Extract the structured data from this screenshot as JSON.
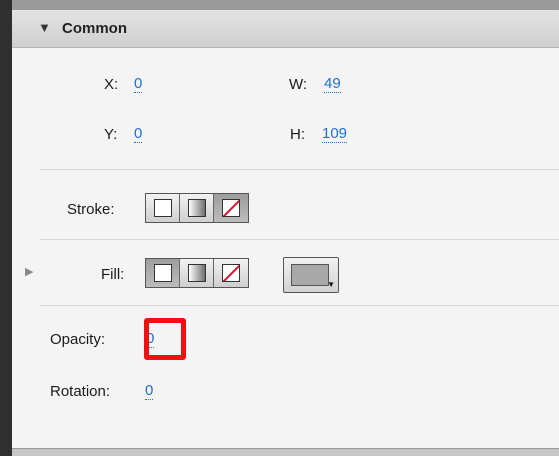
{
  "section": {
    "title": "Common",
    "expand_icon": "triangle-down-icon"
  },
  "position": {
    "x_label": "X:",
    "x_value": "0",
    "y_label": "Y:",
    "y_value": "0"
  },
  "size": {
    "w_label": "W:",
    "w_value": "49",
    "h_label": "H:",
    "h_value": "109"
  },
  "stroke": {
    "label": "Stroke:",
    "options": [
      "solid-swatch-icon",
      "gradient-swatch-icon",
      "none-swatch-icon"
    ],
    "selected": "none"
  },
  "fill": {
    "label": "Fill:",
    "options": [
      "solid-swatch-icon",
      "gradient-swatch-icon",
      "none-swatch-icon"
    ],
    "selected": "solid",
    "color": "#a9a9a9"
  },
  "opacity": {
    "label": "Opacity:",
    "value": "0"
  },
  "rotation": {
    "label": "Rotation:",
    "value": "0"
  },
  "colors": {
    "link": "#1d6ed9",
    "highlight": "#ee1111",
    "none_slash": "#e0102a"
  }
}
